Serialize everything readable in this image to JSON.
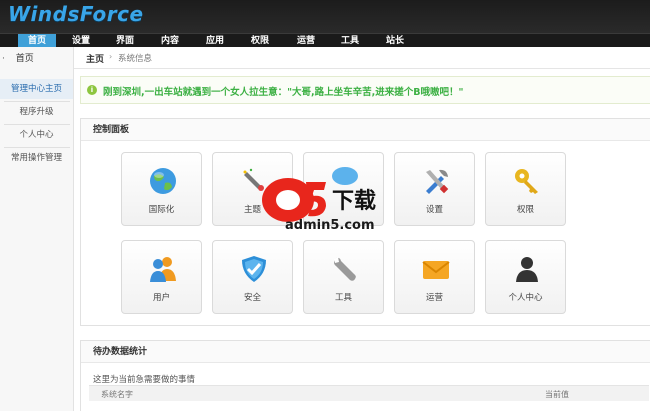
{
  "header": {
    "logo": "WindsForce"
  },
  "nav": {
    "items": [
      {
        "label": "首页",
        "active": true
      },
      {
        "label": "设置"
      },
      {
        "label": "界面"
      },
      {
        "label": "内容"
      },
      {
        "label": "应用"
      },
      {
        "label": "权限"
      },
      {
        "label": "运营"
      },
      {
        "label": "工具"
      },
      {
        "label": "站长"
      }
    ]
  },
  "sidebar": {
    "head": "首页",
    "items": [
      {
        "label": "管理中心主页",
        "active": true
      },
      {
        "label": "程序升级"
      },
      {
        "label": "个人中心"
      },
      {
        "label": "常用操作管理"
      }
    ]
  },
  "breadcrumb": {
    "home": "主页",
    "sep": "›",
    "current": "系统信息"
  },
  "notice": {
    "icon": "info-icon",
    "text": "刚到深圳,一出车站就遇到一个女人拉生意：\"大哥,路上坐车辛苦,进来搓个B哦嗷吧！\""
  },
  "control_panel": {
    "title": "控制面板",
    "tiles": [
      {
        "label": "国际化",
        "icon": "globe-icon"
      },
      {
        "label": "主题",
        "icon": "theme-icon"
      },
      {
        "label": "",
        "icon": "bubble-icon"
      },
      {
        "label": "设置",
        "icon": "tools-icon"
      },
      {
        "label": "权限",
        "icon": "key-icon"
      },
      {
        "label": "用户",
        "icon": "users-icon"
      },
      {
        "label": "安全",
        "icon": "shield-icon"
      },
      {
        "label": "工具",
        "icon": "wrench-icon"
      },
      {
        "label": "运营",
        "icon": "mail-icon"
      },
      {
        "label": "个人中心",
        "icon": "person-icon"
      }
    ]
  },
  "stats": {
    "title": "待办数据统计",
    "desc": "这里为当前急需要做的事情",
    "col_name": "系统名字",
    "col_value": "当前值"
  },
  "watermark": {
    "text": "admin5.com",
    "logo": "a5下载"
  },
  "colors": {
    "accent": "#3fa0d8",
    "notice_green": "#3cb043"
  }
}
